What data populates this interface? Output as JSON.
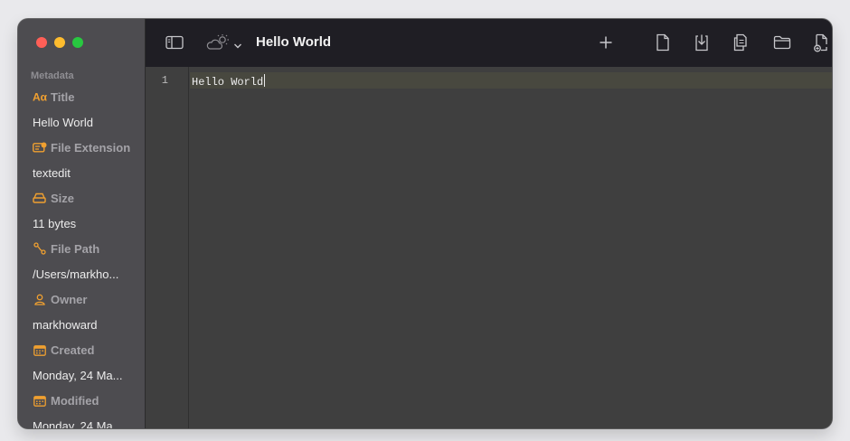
{
  "window": {
    "title": "Hello World"
  },
  "sidebar": {
    "section_title": "Metadata",
    "items": [
      {
        "heading": "Title",
        "icon": "text-format-icon",
        "value": "Hello World"
      },
      {
        "heading": "File Extension",
        "icon": "extension-badge-icon",
        "value": "textedit"
      },
      {
        "heading": "Size",
        "icon": "drive-icon",
        "value": "11 bytes"
      },
      {
        "heading": "File Path",
        "icon": "path-icon",
        "value": "/Users/markho..."
      },
      {
        "heading": "Owner",
        "icon": "person-icon",
        "value": "markhoward"
      },
      {
        "heading": "Created",
        "icon": "calendar-icon",
        "value": "Monday, 24 Ma..."
      },
      {
        "heading": "Modified",
        "icon": "calendar-icon",
        "value": "Monday, 24 Ma..."
      }
    ]
  },
  "toolbar": {
    "icons": [
      "sidebar-toggle-icon",
      "weather-theme-icon",
      "chevron-down-icon",
      "plus-icon",
      "new-document-icon",
      "download-document-icon",
      "duplicate-document-icon",
      "folder-icon",
      "export-document-icon"
    ]
  },
  "editor": {
    "line_numbers": [
      "1"
    ],
    "lines": [
      "Hello World"
    ]
  },
  "colors": {
    "accent_orange": "#f0a030",
    "sidebar_bg": "#4d4c50",
    "toolbar_bg": "#1f1e24",
    "editor_bg": "#3f3f3f"
  }
}
